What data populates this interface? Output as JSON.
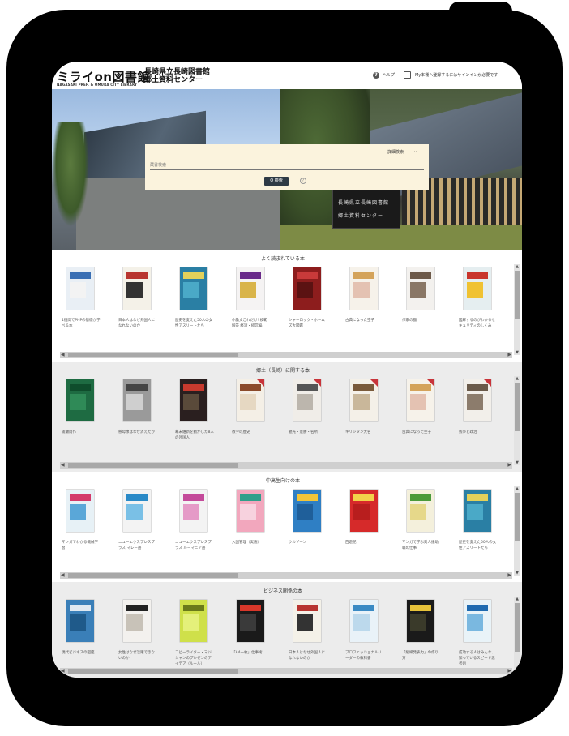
{
  "header": {
    "logo_mark": "ミライon図書館",
    "logo_sub": "NAGASAKI PREF. & OMURA CITY LIBRARY",
    "logo_title_line1": "長崎県立長崎図書館",
    "logo_title_line2": "郷土資料センター",
    "help_icon": "help-circle-icon",
    "help_label": "ヘルプ",
    "book_icon": "book-icon",
    "signin_text": "My本棚へ登録するにはサインインが必要です"
  },
  "hero": {
    "sign_line1": "長崎県立長崎図書館",
    "sign_line2": "郷土資料センター"
  },
  "search": {
    "advanced_label": "詳細検索",
    "advanced_icon": "chevron-down-icon",
    "placeholder": "蔵書検索",
    "button_label": "Q 検索",
    "info_icon": "info-circle-icon"
  },
  "sections": [
    {
      "title": "よく読まれている本",
      "books": [
        {
          "caption": "1週間でPHPの基礎が学べる本",
          "color": "#e9eff5",
          "accent": "#3a6fb4",
          "band": "#f3f3f3"
        },
        {
          "caption": "日本人はなぜ外国人になれないのか",
          "color": "#f4f1e8",
          "accent": "#b8352f",
          "band": "#333333"
        },
        {
          "caption": "歴史を変えた50人の女性アスリートたち",
          "color": "#2a7fa4",
          "accent": "#e3d15a",
          "band": "#4aa9c7"
        },
        {
          "caption": "小論文これだけ! 模範解答 経済・経営編",
          "color": "#f5f3f3",
          "accent": "#6a2a8a",
          "band": "#d9b44a"
        },
        {
          "caption": "シャーロック・ホームズ大図鑑",
          "color": "#8d1d1d",
          "accent": "#c93a3a",
          "band": "#5b1212"
        },
        {
          "caption": "古典になった空子",
          "color": "#f6f2ea",
          "accent": "#d4a35a",
          "band": "#e4c2b2"
        },
        {
          "caption": "作家の猫",
          "color": "#f3f1ee",
          "accent": "#6d5a4a",
          "band": "#8a7766"
        },
        {
          "caption": "図解するのがわかるセキュリティのしくみ",
          "color": "#e5eef0",
          "accent": "#c9352c",
          "band": "#f0c232"
        }
      ]
    },
    {
      "title": "郷土（長崎）に関する本",
      "books": [
        {
          "caption": "浦瀬周作",
          "color": "#1e6b42",
          "accent": "#0f4d2c",
          "band": "#2f8a57"
        },
        {
          "caption": "慈母像はなぜ消えたか",
          "color": "#9a9a9a",
          "accent": "#444444",
          "band": "#cfcfcf"
        },
        {
          "caption": "幕末維新を動かした8人の外国人",
          "color": "#2a1f1f",
          "accent": "#c73a2e",
          "band": "#5a4a3a"
        },
        {
          "caption": "教学の歴史",
          "color": "#f4efe6",
          "accent": "#8b4a2a",
          "band": "#e6d8c2"
        },
        {
          "caption": "観光・景勝・名所",
          "color": "#f0ede8",
          "accent": "#555555",
          "band": "#bcb6ad"
        },
        {
          "caption": "キリシタン大名",
          "color": "#f4f0e8",
          "accent": "#7a5a3a",
          "band": "#c9b79a"
        },
        {
          "caption": "古典になった空子",
          "color": "#f6f2ea",
          "accent": "#d4a35a",
          "band": "#e4c2b2"
        },
        {
          "caption": "残争と政治",
          "color": "#f2efea",
          "accent": "#6a5a4a",
          "band": "#8c7c6c"
        }
      ]
    },
    {
      "title": "中高生向けの本",
      "books": [
        {
          "caption": "マンガでわかる機械学習",
          "color": "#e7f1f6",
          "accent": "#d43a6a",
          "band": "#5aa7d8"
        },
        {
          "caption": "ニューエクスプレスプラス マレー語",
          "color": "#f3f3f3",
          "accent": "#2a8ac7",
          "band": "#7ac0e6"
        },
        {
          "caption": "ニューエクスプレスプラス ルーマニア語",
          "color": "#f3f3f3",
          "accent": "#c44a9a",
          "band": "#e59ac7"
        },
        {
          "caption": "入国管理（実施）",
          "color": "#f2a7bd",
          "accent": "#2f9f8a",
          "band": "#f7d2de"
        },
        {
          "caption": "クルゾーン",
          "color": "#2f7fc4",
          "accent": "#f2c53a",
          "band": "#1f5f9a"
        },
        {
          "caption": "西遊記",
          "color": "#d62a2a",
          "accent": "#f2d24a",
          "band": "#b81e1e"
        },
        {
          "caption": "マンガで学ぶ対人援助職の仕事",
          "color": "#f4f0dc",
          "accent": "#4a9a3a",
          "band": "#e6d88a"
        },
        {
          "caption": "歴史を変えた50人の女性アスリートたち",
          "color": "#2a7fa4",
          "accent": "#e3d15a",
          "band": "#4aa9c7"
        }
      ]
    },
    {
      "title": "ビジネス関係の本",
      "books": [
        {
          "caption": "現代ビジネスの図鑑",
          "color": "#3a7fb8",
          "accent": "#dfe8f0",
          "band": "#1f5a8a"
        },
        {
          "caption": "女性はなぜ活躍できないのか",
          "color": "#f3f1ee",
          "accent": "#222222",
          "band": "#c8c2b8"
        },
        {
          "caption": "コピーライター・マジシャンのプレゼンのアイデア（ルール）",
          "color": "#cfe04a",
          "accent": "#6a7a1a",
          "band": "#e4f07a"
        },
        {
          "caption": "「A4一枚」仕事術",
          "color": "#1a1a1a",
          "accent": "#d8372a",
          "band": "#3a3a3a"
        },
        {
          "caption": "日本人はなぜ外国人になれないのか",
          "color": "#f4f1e8",
          "accent": "#b8352f",
          "band": "#333333"
        },
        {
          "caption": "プロフェッショナルリーダーの教科書",
          "color": "#e9f2f8",
          "accent": "#3a8ac4",
          "band": "#bcd9ec"
        },
        {
          "caption": "「組織発表力」の作り方",
          "color": "#1a1a1a",
          "accent": "#e6c23a",
          "band": "#3a3a2a"
        },
        {
          "caption": "成功する人はみんな、知っているスピード思考術",
          "color": "#e9f3f8",
          "accent": "#1f6ab0",
          "band": "#7ab8e0"
        }
      ]
    }
  ],
  "scroll": {
    "left_arrow": "◀",
    "right_arrow": "▶",
    "up_arrow": "▲",
    "down_arrow": "▼"
  }
}
